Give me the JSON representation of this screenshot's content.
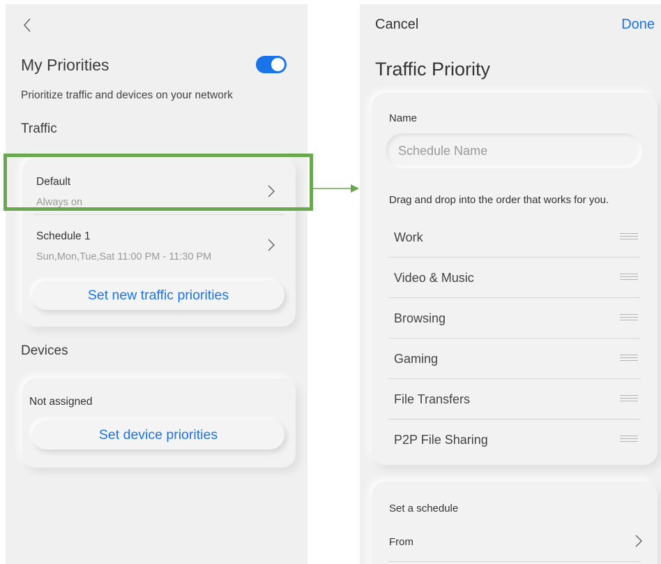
{
  "left": {
    "title": "My Priorities",
    "priorities_enabled": true,
    "subtitle": "Prioritize traffic and devices on your network",
    "traffic_heading": "Traffic",
    "traffic_rows": [
      {
        "title": "Default",
        "subtitle": "Always on"
      },
      {
        "title": "Schedule 1",
        "subtitle": "Sun,Mon,Tue,Sat 11:00 PM - 11:30 PM"
      }
    ],
    "new_traffic_button": "Set new traffic priorities",
    "devices_heading": "Devices",
    "devices_status": "Not assigned",
    "device_button": "Set device priorities"
  },
  "right": {
    "cancel": "Cancel",
    "done": "Done",
    "title": "Traffic Priority",
    "name_label": "Name",
    "name_placeholder": "Schedule Name",
    "name_value": "",
    "drag_hint": "Drag and drop into the order that works for you.",
    "priorities": [
      "Work",
      "Video & Music",
      "Browsing",
      "Gaming",
      "File Transfers",
      "P2P File Sharing"
    ],
    "schedule_label": "Set a schedule",
    "from_label": "From"
  },
  "colors": {
    "accent": "#1a73e8",
    "highlight": "#6aa84f",
    "background": "#f0f0f0"
  },
  "icons": [
    "chevron-left-icon",
    "chevron-right-icon",
    "drag-handle-icon",
    "arrow-right-icon"
  ]
}
